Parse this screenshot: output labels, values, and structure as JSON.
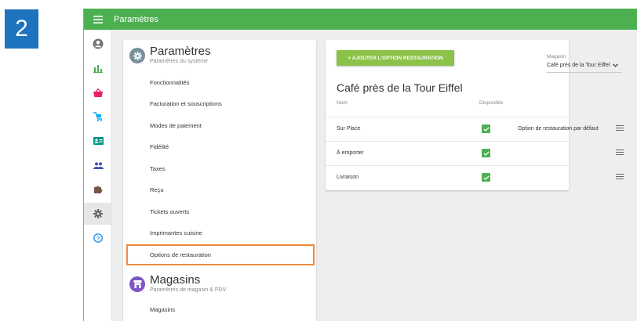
{
  "step_number": "2",
  "topbar": {
    "title": "Paramètres"
  },
  "rail": {
    "items": [
      {
        "name": "account-icon"
      },
      {
        "name": "reports-icon"
      },
      {
        "name": "items-icon"
      },
      {
        "name": "pos-icon"
      },
      {
        "name": "employees-icon"
      },
      {
        "name": "customers-icon"
      },
      {
        "name": "integrations-icon"
      },
      {
        "name": "settings-icon",
        "active": true
      },
      {
        "name": "help-icon"
      }
    ]
  },
  "settings": {
    "title": "Paramètres",
    "subtitle": "Paramètres du système",
    "items": [
      "Fonctionnalités",
      "Facturation et souscriptions",
      "Modes de paiement",
      "Fidélité",
      "Taxes",
      "Reçu",
      "Tickets ouverts",
      "Imprimantes cuisine",
      "Options de restauration"
    ],
    "stores_section": {
      "title": "Magasins",
      "subtitle": "Paramètres de magasin & PDV",
      "items": [
        "Magasins"
      ]
    }
  },
  "main": {
    "add_button": "+ AJOUTER L'OPTION RESTAURATION",
    "store_label": "Magasin",
    "store_value": "Café près de la Tour Eiffel",
    "title": "Café près de la Tour Eiffel",
    "columns": {
      "name": "Nom",
      "available": "Disponible"
    },
    "rows": [
      {
        "name": "Sur Place",
        "available": true,
        "default": "Option de restauration par défaut"
      },
      {
        "name": "À emporter",
        "available": true,
        "default": ""
      },
      {
        "name": "Livraison",
        "available": true,
        "default": ""
      }
    ]
  },
  "colors": {
    "topbar": "#4caf50",
    "add_button": "#8bc34a",
    "highlight": "#f08a3c",
    "step_badge": "#1e73be"
  }
}
